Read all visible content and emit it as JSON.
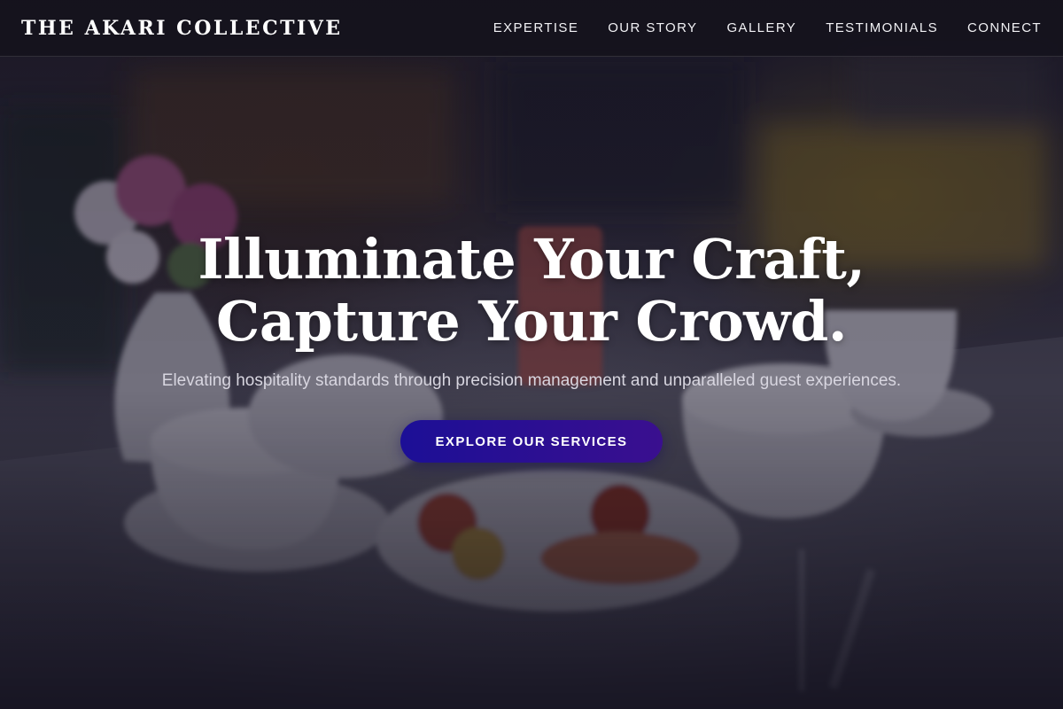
{
  "header": {
    "brand": "THE AKARI COLLECTIVE",
    "nav": [
      {
        "label": "EXPERTISE"
      },
      {
        "label": "OUR STORY"
      },
      {
        "label": "GALLERY"
      },
      {
        "label": "TESTIMONIALS"
      },
      {
        "label": "CONNECT"
      }
    ]
  },
  "hero": {
    "headline_line1": "Illuminate Your Craft,",
    "headline_line2": "Capture Your Crowd.",
    "subheadline": "Elevating hospitality standards through precision management and unparalleled guest experiences.",
    "cta_label": "EXPLORE OUR SERVICES"
  },
  "colors": {
    "cta_start": "#1c0f96",
    "cta_end": "#3a0f8f",
    "navbar_bg": "#14121c",
    "overlay": "#100e1e"
  }
}
